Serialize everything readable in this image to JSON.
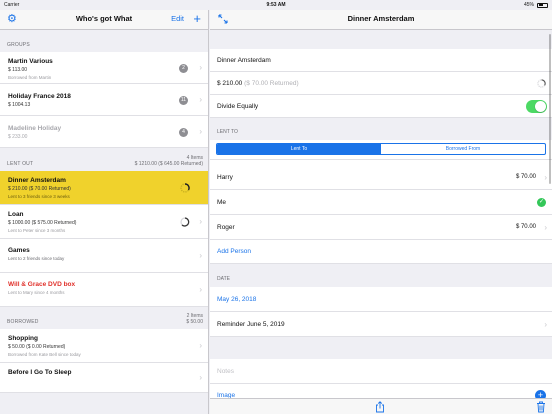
{
  "status": {
    "carrier": "Carrier",
    "time": "9:53 AM",
    "battery": "45%"
  },
  "left": {
    "title": "Who's got What",
    "edit_label": "Edit",
    "sections": {
      "groups": {
        "label": "GROUPS"
      },
      "lent_out": {
        "label": "LENT OUT",
        "meta1": "4 Items",
        "meta2": "$ 1210.00 ($ 645.00 Returned)"
      },
      "borrowed": {
        "label": "BORROWED",
        "meta1": "2 Items",
        "meta2": "$ 50.00"
      }
    },
    "groups": [
      {
        "title": "Martin Various",
        "line1": "$ 113.00",
        "line2": "Borrowed from Martin",
        "badge": "2"
      },
      {
        "title": "Holiday France 2018",
        "line1": "$ 1004.13",
        "line2": "",
        "badge": "11"
      },
      {
        "title": "Madeline Holiday",
        "line1": "$ 233.00",
        "line2": "",
        "badge": "4"
      }
    ],
    "lent_out": [
      {
        "title": "Dinner Amsterdam",
        "line1": "$ 210.00 ($ 70.00 Returned)",
        "line2": "Lent to 3 friends since 3 weeks"
      },
      {
        "title": "Loan",
        "line1": "$ 1000.00 ($ 575.00 Returned)",
        "line2": "Lent to Peter since 3 months"
      },
      {
        "title": "Games",
        "line1": "Lent to 2 friends since today",
        "line2": ""
      },
      {
        "title": "Will & Grace DVD box",
        "line1": "Lent to Mary since 4 months",
        "line2": ""
      }
    ],
    "borrowed": [
      {
        "title": "Shopping",
        "line1": "$ 50.00 ($ 0.00 Returned)",
        "line2": "Borrowed from Kate Bell since today"
      },
      {
        "title": "Before I Go To Sleep",
        "line1": "",
        "line2": ""
      }
    ]
  },
  "detail": {
    "title": "Dinner Amsterdam",
    "name_value": "Dinner Amsterdam",
    "amount": "$ 210.00",
    "amount_returned": "($ 70.00 Returned)",
    "divide_label": "Divide Equally",
    "lent_to_header": "LENT TO",
    "seg_lent_to": "Lent To",
    "seg_borrowed_from": "Borrowed From",
    "people": [
      {
        "name": "Harry",
        "amount": "$ 70.00"
      },
      {
        "name": "Me",
        "amount": ""
      },
      {
        "name": "Roger",
        "amount": "$ 70.00"
      }
    ],
    "add_person": "Add Person",
    "date_header": "DATE",
    "date_value": "May 26, 2018",
    "reminder": "Reminder June 5, 2019",
    "notes_placeholder": "Notes",
    "image_label": "Image"
  },
  "colors": {
    "accent": "#1a73e8",
    "selected": "#f0d22c",
    "toggle_on": "#4cd964",
    "alert": "#e0302a"
  }
}
